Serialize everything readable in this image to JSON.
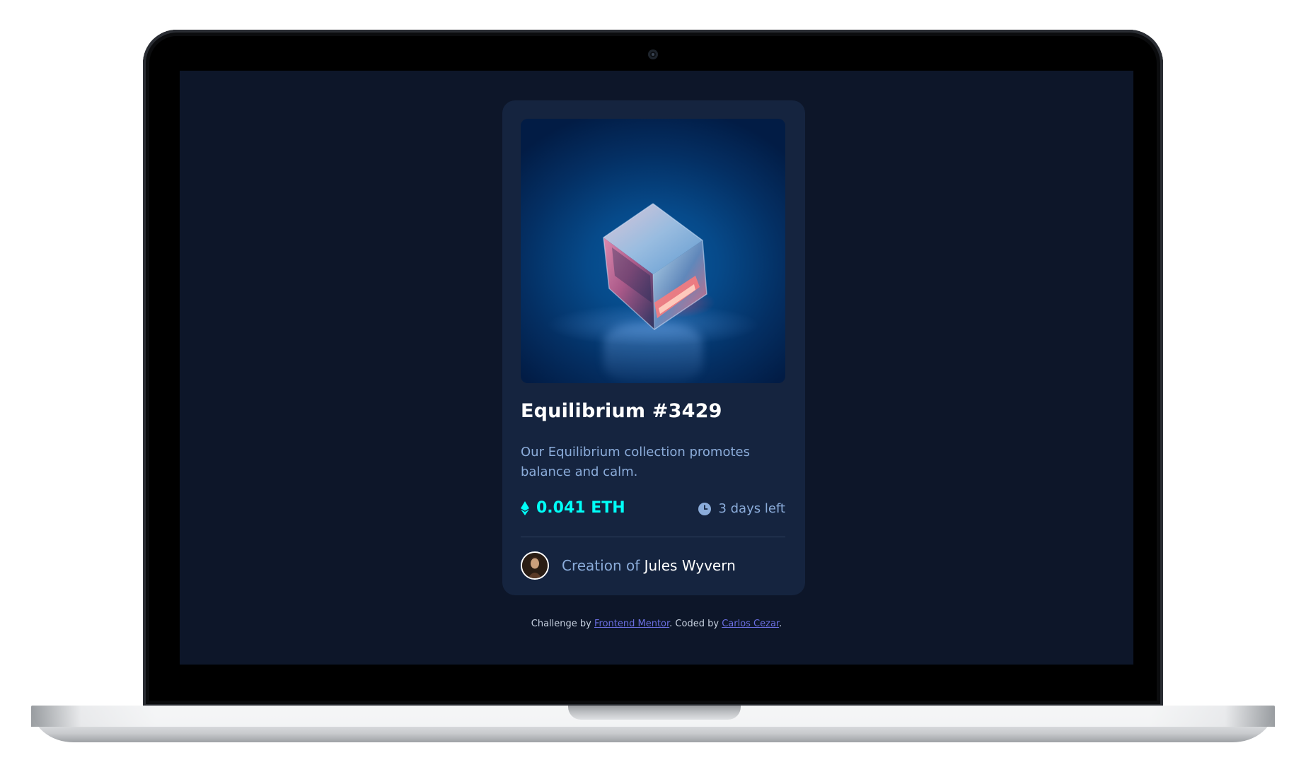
{
  "card": {
    "title": "Equilibrium #3429",
    "description": "Our Equilibrium collection promotes balance and calm.",
    "price": "0.041 ETH",
    "time_left": "3 days left",
    "creator_prefix": "Creation of ",
    "creator_name": "Jules Wyvern",
    "icons": {
      "price": "ethereum-icon",
      "timer": "clock-icon",
      "avatar": "avatar-image"
    }
  },
  "footer": {
    "prefix": "Challenge by ",
    "link1": "Frontend Mentor",
    "middle": ". Coded by ",
    "link2": "Carlos Cezar",
    "suffix": "."
  },
  "colors": {
    "page_bg": "#0d1629",
    "card_bg": "#15243f",
    "cyan": "#00fff8",
    "soft_blue": "#8bacda",
    "white": "#ffffff"
  }
}
